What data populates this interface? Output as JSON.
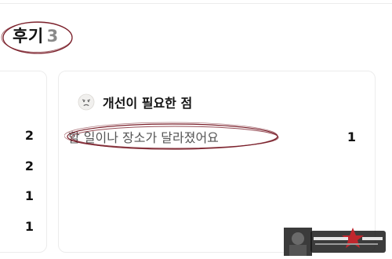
{
  "reviews": {
    "title": "후기",
    "count": "3"
  },
  "left_card": {
    "counts": [
      "2",
      "2",
      "1",
      "1"
    ]
  },
  "improvements": {
    "title": "개선이 필요한 점",
    "icon": "sad-face-icon",
    "items": [
      {
        "label": "할 일이나 장소가 달라졌어요",
        "count": "1"
      }
    ]
  },
  "colors": {
    "annotation_ring": "#7a1f2a",
    "count_gray": "#8a8a8a",
    "card_border": "#ececec"
  }
}
